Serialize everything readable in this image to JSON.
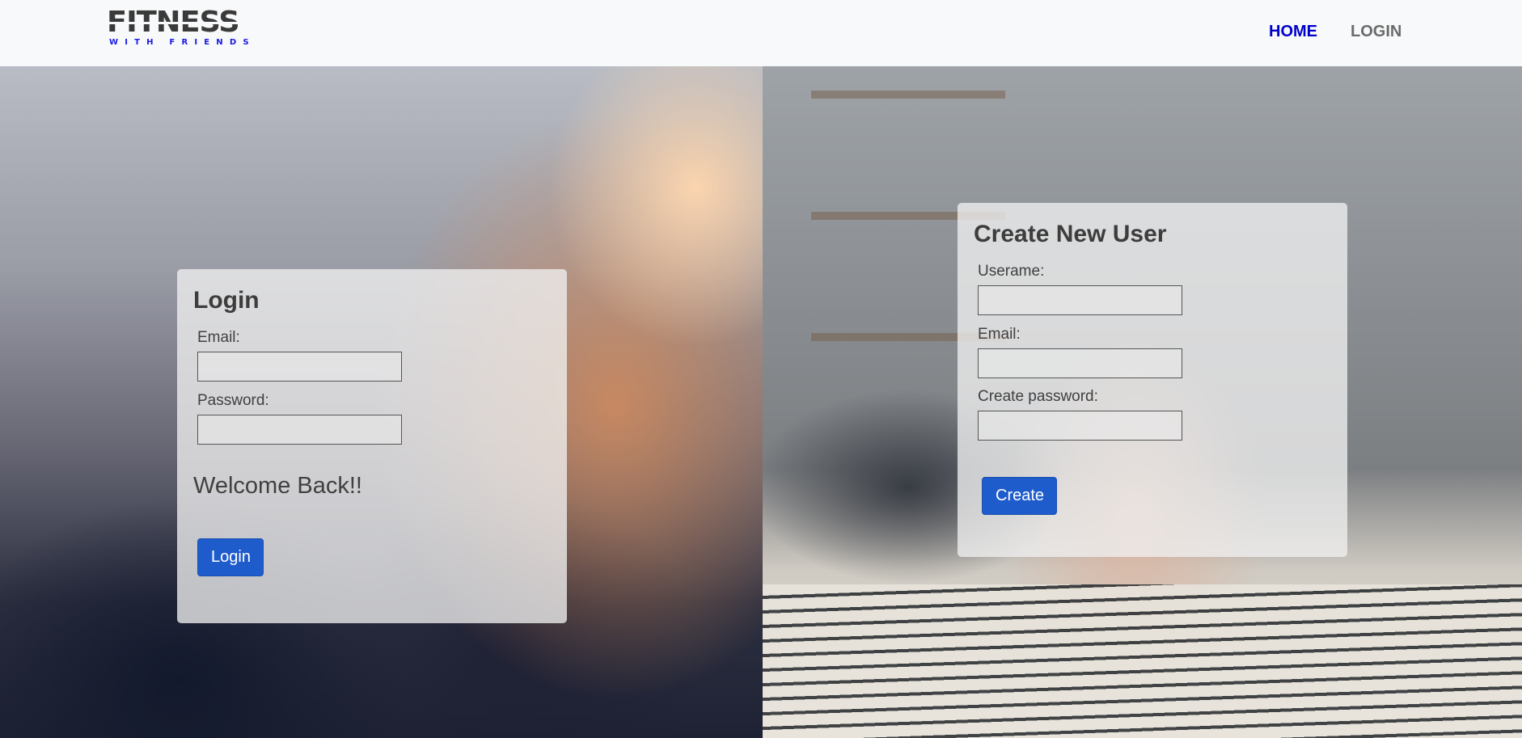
{
  "brand": {
    "name": "FITNESS",
    "tagline": "WITH FRIENDS",
    "tagline_color": "#1a1ae6"
  },
  "nav": {
    "home_label": "HOME",
    "login_label": "LOGIN",
    "active": "HOME",
    "active_color": "#0000cc"
  },
  "login_form": {
    "title": "Login",
    "email_label": "Email:",
    "email_value": "",
    "password_label": "Password:",
    "password_value": "",
    "welcome_text": "Welcome Back!!",
    "submit_label": "Login"
  },
  "create_form": {
    "title": "Create New User",
    "username_label": "Userame:",
    "username_value": "",
    "email_label": "Email:",
    "email_value": "",
    "password_label": "Create password:",
    "password_value": "",
    "submit_label": "Create"
  },
  "colors": {
    "button": "#1f5ccb",
    "card": "rgba(240,240,240,0.78)",
    "navbar": "#f8f9fa"
  }
}
